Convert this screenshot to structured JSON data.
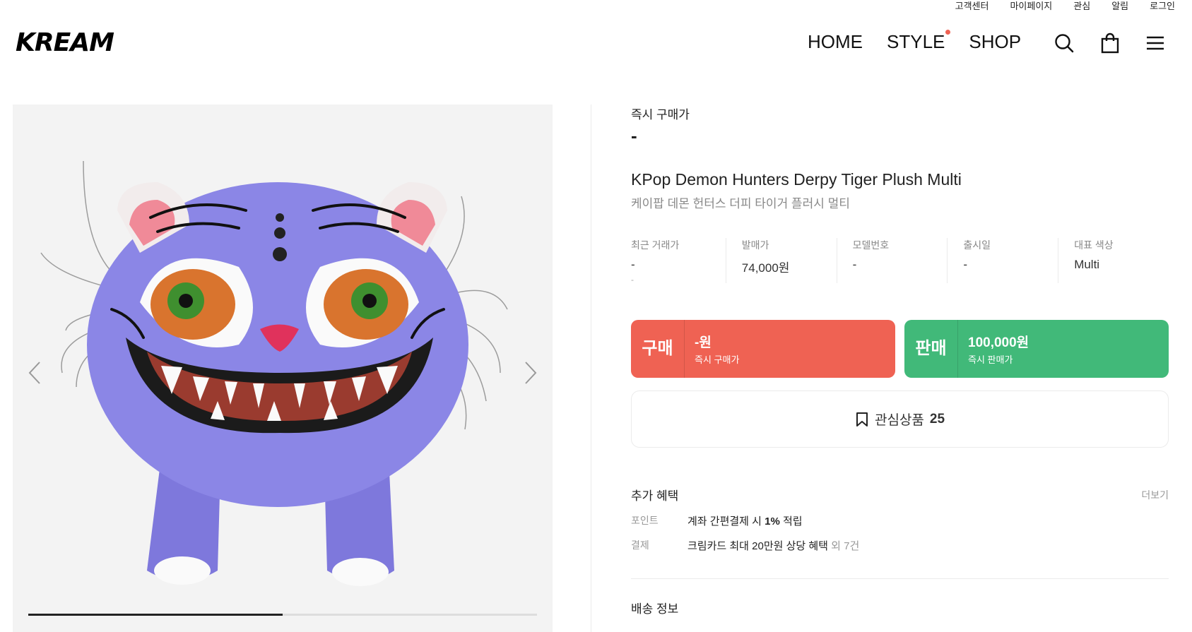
{
  "utility_links": [
    "고객센터",
    "마이페이지",
    "관심",
    "알림",
    "로그인"
  ],
  "logo": "KREAM",
  "nav": {
    "home": "HOME",
    "style": "STYLE",
    "shop": "SHOP"
  },
  "icons": {
    "search": "search-icon",
    "bag": "shopping-bag-icon",
    "menu": "hamburger-menu-icon"
  },
  "product": {
    "instant_buy_label": "즉시 구매가",
    "instant_buy_price": "-",
    "name_en": "KPop Demon Hunters Derpy Tiger Plush Multi",
    "name_ko": "케이팝 데몬 헌터스 더피 타이거 플러시 멀티",
    "info": [
      {
        "key": "최근 거래가",
        "value": "-",
        "sub": "-"
      },
      {
        "key": "발매가",
        "value": "74,000원"
      },
      {
        "key": "모델번호",
        "value": "-"
      },
      {
        "key": "출시일",
        "value": "-"
      },
      {
        "key": "대표 색상",
        "value": "Multi"
      }
    ]
  },
  "buy_button": {
    "title": "구매",
    "price": "-원",
    "sub": "즉시 구매가"
  },
  "sell_button": {
    "title": "판매",
    "price": "100,000원",
    "sub": "즉시 판매가"
  },
  "wish": {
    "label": "관심상품",
    "count": "25"
  },
  "benefit": {
    "title": "추가 혜택",
    "more": "더보기",
    "rows": [
      {
        "key": "포인트",
        "pre": "계좌 간편결제 시 ",
        "strong": "1%",
        "post": " 적립",
        "extra": ""
      },
      {
        "key": "결제",
        "pre": "크림카드 최대 20만원 상당 혜택",
        "strong": "",
        "post": "",
        "extra": " 외 7건"
      }
    ]
  },
  "shipping_title": "배송 정보",
  "gallery": {
    "progress": 0.5
  },
  "colors": {
    "buy": "#ef6253",
    "sell": "#41b979",
    "plush": "#8b86e6"
  }
}
